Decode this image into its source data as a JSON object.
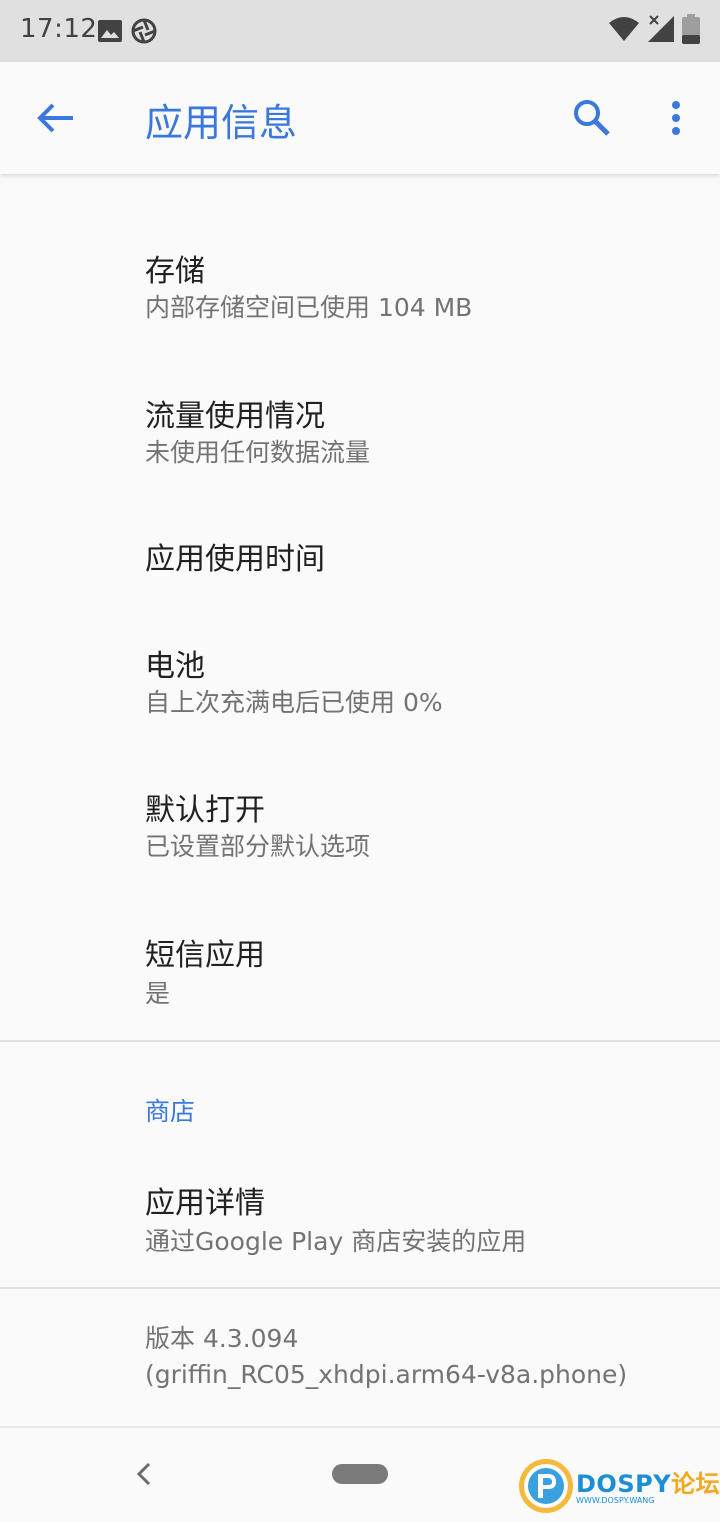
{
  "status_bar": {
    "time": "17:12",
    "left_icons": [
      "image-icon",
      "aperture-icon"
    ],
    "right_icons": [
      "wifi-icon",
      "cellular-no-signal-icon",
      "battery-icon"
    ]
  },
  "app_bar": {
    "title": "应用信息",
    "back_icon": "arrow-back-icon",
    "search_icon": "search-icon",
    "more_icon": "more-vert-icon"
  },
  "items": [
    {
      "title": "存储",
      "summary": "内部存储空间已使用 104 MB"
    },
    {
      "title": "流量使用情况",
      "summary": "未使用任何数据流量"
    },
    {
      "title": "应用使用时间",
      "summary": ""
    },
    {
      "title": "电池",
      "summary": "自上次充满电后已使用 0%"
    },
    {
      "title": "默认打开",
      "summary": "已设置部分默认选项"
    },
    {
      "title": "短信应用",
      "summary": "是"
    }
  ],
  "store_section": {
    "header": "商店",
    "item": {
      "title": "应用详情",
      "summary": "通过Google Play 商店安装的应用"
    }
  },
  "version": {
    "line1": "版本 4.3.094",
    "line2": "(griffin_RC05_xhdpi.arm64-v8a.phone)"
  },
  "nav_bar": {
    "back_icon": "nav-back-icon",
    "home_pill": "home-pill"
  },
  "watermark": {
    "brand": "DOSPY",
    "brand_cn": "论坛",
    "sub": "WWW.DOSPY.WANG"
  },
  "colors": {
    "accent": "#3b78dc",
    "primary_text": "#212121",
    "secondary_text": "#737373",
    "background": "#fafafa",
    "status_bar": "#e0e0e0"
  }
}
